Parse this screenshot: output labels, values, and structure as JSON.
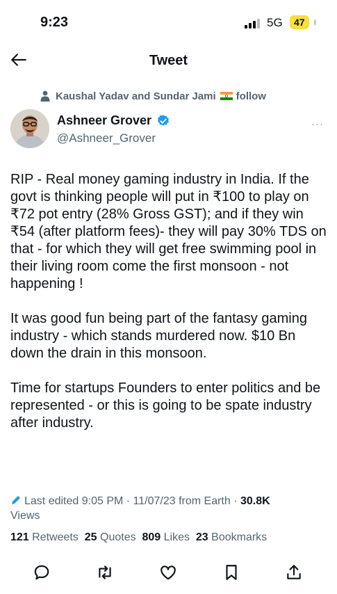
{
  "status_bar": {
    "time": "9:23",
    "network": "5G",
    "battery": "47"
  },
  "nav": {
    "title": "Tweet"
  },
  "social_context": {
    "text": "Kaushal Yadav and Sundar Jami",
    "suffix": "follow"
  },
  "author": {
    "name": "Ashneer Grover",
    "handle": "@Ashneer_Grover",
    "more": "···"
  },
  "tweet": {
    "paragraphs": [
      "RIP - Real money gaming industry in India. If the govt is thinking people will put in ₹100 to play on ₹72 pot entry (28% Gross GST); and if they win ₹54 (after platform fees)- they will pay 30% TDS on that - for which they will get free swimming pool in their living room come the first monsoon - not happening !",
      "It was good fun being part of the fantasy gaming industry - which stands murdered now. $10 Bn down the drain in this monsoon.",
      "Time for startups Founders to enter politics and be represented - or this is going to be spate industry after industry."
    ]
  },
  "meta": {
    "edited": "Last edited 9:05 PM · 11/07/23",
    "source": "from Earth",
    "separator": "·",
    "views_count": "30.8K",
    "views_label": "Views"
  },
  "stats": {
    "retweets_count": "121",
    "retweets_label": "Retweets",
    "quotes_count": "25",
    "quotes_label": "Quotes",
    "likes_count": "809",
    "likes_label": "Likes",
    "bookmarks_count": "23",
    "bookmarks_label": "Bookmarks"
  },
  "icons": {
    "back": "arrow-left-icon",
    "person": "person-icon",
    "flag": "india-flag-icon",
    "verified": "verified-badge-icon",
    "edit": "pencil-icon",
    "reply": "reply-icon",
    "retweet": "retweet-icon",
    "like": "heart-icon",
    "bookmark": "bookmark-icon",
    "share": "share-icon"
  },
  "colors": {
    "text": "#0f1419",
    "secondary": "#536471",
    "verified": "#1d9bf0",
    "battery": "#f7df3c"
  }
}
